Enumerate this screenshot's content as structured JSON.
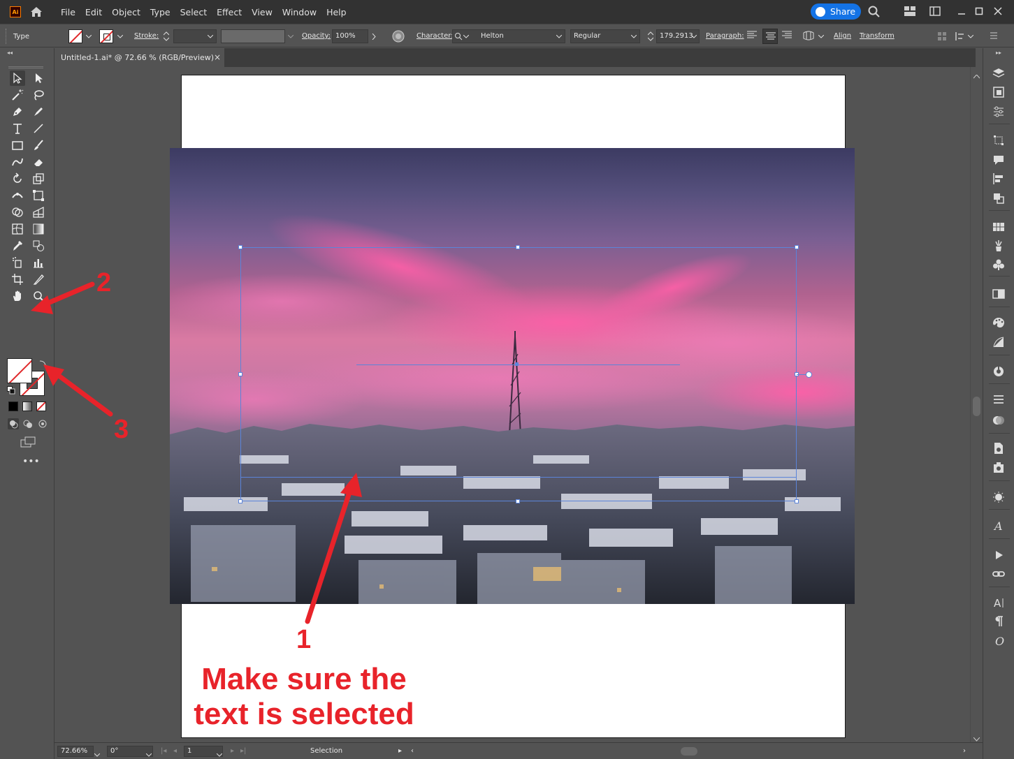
{
  "app": {
    "logo_text": "Ai"
  },
  "menu": [
    "File",
    "Edit",
    "Object",
    "Type",
    "Select",
    "Effect",
    "View",
    "Window",
    "Help"
  ],
  "share": {
    "label": "Share"
  },
  "control_bar": {
    "mode_label": "Type",
    "stroke_label": "Stroke:",
    "opacity_label": "Opacity:",
    "opacity_value": "100%",
    "character_label": "Character:",
    "font_family": "Helton",
    "font_style": "Regular",
    "font_size": "179.2913",
    "paragraph_label": "Paragraph:",
    "align_label": "Align",
    "transform_label": "Transform"
  },
  "document_tab": {
    "title": "Untitled-1.ai* @ 72.66 % (RGB/Preview)",
    "close": "×"
  },
  "status_bar": {
    "zoom": "72.66%",
    "rotation": "0°",
    "artboard": "1",
    "tool": "Selection"
  },
  "annotations": {
    "n1": "1",
    "n2": "2",
    "n3": "3",
    "note_line1": "Make sure the",
    "note_line2": "text is selected",
    "color": "#e8232a"
  },
  "colors": {
    "accent": "#1473e6",
    "selection": "#5b84d9",
    "panel": "#535353",
    "menubar": "#323232"
  }
}
